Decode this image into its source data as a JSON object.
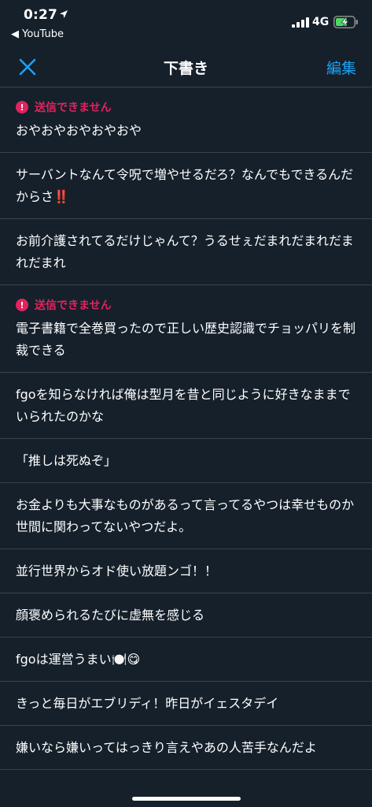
{
  "status_bar": {
    "time": "0:27",
    "back_app": "◀ YouTube",
    "network": "4G",
    "location_icon": "location-arrow-icon",
    "signal_icon": "signal-bars-icon",
    "battery_icon": "battery-charging-icon",
    "battery_color": "#4cd964"
  },
  "nav": {
    "title": "下書き",
    "edit_label": "編集",
    "close_icon": "close-icon",
    "accent_color": "#1da1f2"
  },
  "error_color": "#e0245e",
  "drafts": [
    {
      "error": "送信できません",
      "text": "おやおやおやおやおや"
    },
    {
      "error": null,
      "text": "サーバントなんて令呪で増やせるだろ？なんでもできるんだからさ‼️"
    },
    {
      "error": null,
      "text": "お前介護されてるだけじゃんて？うるせぇだまれだまれだまれだまれ"
    },
    {
      "error": "送信できません",
      "text": "電子書籍で全巻買ったので正しい歴史認識でチョッパリを制裁できる"
    },
    {
      "error": null,
      "text": "fgoを知らなければ俺は型月を昔と同じように好きなままでいられたのかな"
    },
    {
      "error": null,
      "text": "「推しは死ぬぞ」"
    },
    {
      "error": null,
      "text": "お金よりも大事なものがあるって言ってるやつは幸せものか世間に関わってないやつだよ。"
    },
    {
      "error": null,
      "text": "並行世界からオド使い放題ンゴ！！"
    },
    {
      "error": null,
      "text": "顔褒められるたびに虚無を感じる"
    },
    {
      "error": null,
      "text": "fgoは運営うまい🍽️😋"
    },
    {
      "error": null,
      "text": "きっと毎日がエブリディ！昨日がイェスタデイ"
    },
    {
      "error": null,
      "text": "嫌いなら嫌いってはっきり言えやあの人苦手なんだよ"
    }
  ]
}
